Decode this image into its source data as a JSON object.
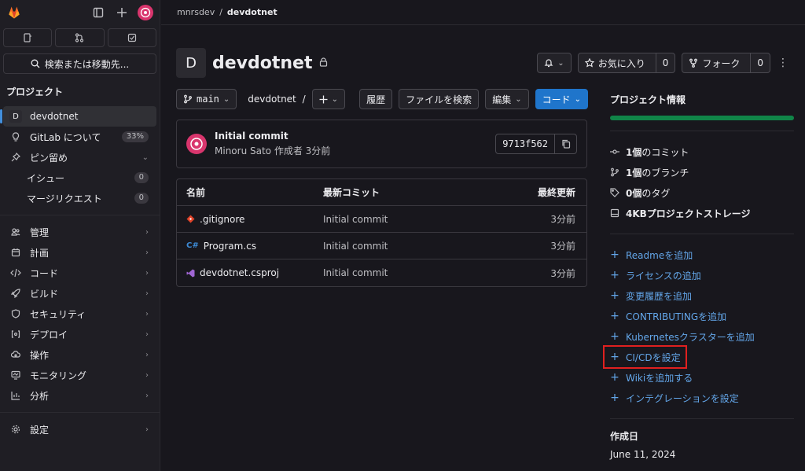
{
  "sidebar": {
    "search_label": "検索または移動先...",
    "section_title": "プロジェクト",
    "project": {
      "letter": "D",
      "name": "devdotnet"
    },
    "items": [
      {
        "label": "GitLab について",
        "badge": "33%"
      },
      {
        "label": "ピン留め"
      },
      {
        "label": "イシュー",
        "badge": "0"
      },
      {
        "label": "マージリクエスト",
        "badge": "0"
      },
      {
        "label": "管理"
      },
      {
        "label": "計画"
      },
      {
        "label": "コード"
      },
      {
        "label": "ビルド"
      },
      {
        "label": "セキュリティ"
      },
      {
        "label": "デプロイ"
      },
      {
        "label": "操作"
      },
      {
        "label": "モニタリング"
      },
      {
        "label": "分析"
      },
      {
        "label": "設定"
      }
    ]
  },
  "breadcrumb": {
    "group": "mnrsdev",
    "separator": "/",
    "project": "devdotnet"
  },
  "project": {
    "avatar_letter": "D",
    "title": "devdotnet"
  },
  "header_actions": {
    "favorite_label": "お気に入り",
    "favorite_count": "0",
    "fork_label": "フォーク",
    "fork_count": "0"
  },
  "repo_bar": {
    "branch": "main",
    "path": "devdotnet",
    "path_sep": "/",
    "history": "履歴",
    "find_file": "ファイルを検索",
    "edit": "編集",
    "code": "コード"
  },
  "commit": {
    "title": "Initial commit",
    "meta": "Minoru Sato 作成者 3分前",
    "sha": "9713f562"
  },
  "files": {
    "headers": {
      "name": "名前",
      "last_commit": "最新コミット",
      "last_update": "最終更新"
    },
    "rows": [
      {
        "icon": "git-icon",
        "name": ".gitignore",
        "commit": "Initial commit",
        "updated": "3分前"
      },
      {
        "icon": "csharp-icon",
        "name": "Program.cs",
        "commit": "Initial commit",
        "updated": "3分前"
      },
      {
        "icon": "vs-icon",
        "name": "devdotnet.csproj",
        "commit": "Initial commit",
        "updated": "3分前"
      }
    ]
  },
  "project_info": {
    "title": "プロジェクト情報",
    "progress_fraction": 1.0,
    "stats": [
      {
        "icon": "commit-icon",
        "value": "1個",
        "label": "のコミット"
      },
      {
        "icon": "branch-icon",
        "value": "1個",
        "label": "のブランチ"
      },
      {
        "icon": "tag-icon",
        "value": "0個",
        "label": "のタグ"
      },
      {
        "icon": "storage-icon",
        "value": "4KB",
        "label": "プロジェクトストレージ"
      }
    ],
    "links": [
      "Readmeを追加",
      "ライセンスの追加",
      "変更履歴を追加",
      "CONTRIBUTINGを追加",
      "Kubernetesクラスターを追加",
      "CI/CDを設定",
      "Wikiを追加する",
      "インテグレーションを設定"
    ],
    "created_label": "作成日",
    "created_date": "June 11, 2024"
  },
  "colors": {
    "accent": "#1f75cb",
    "link": "#63a6e9",
    "progress": "#108548",
    "highlight": "#e0201f"
  }
}
